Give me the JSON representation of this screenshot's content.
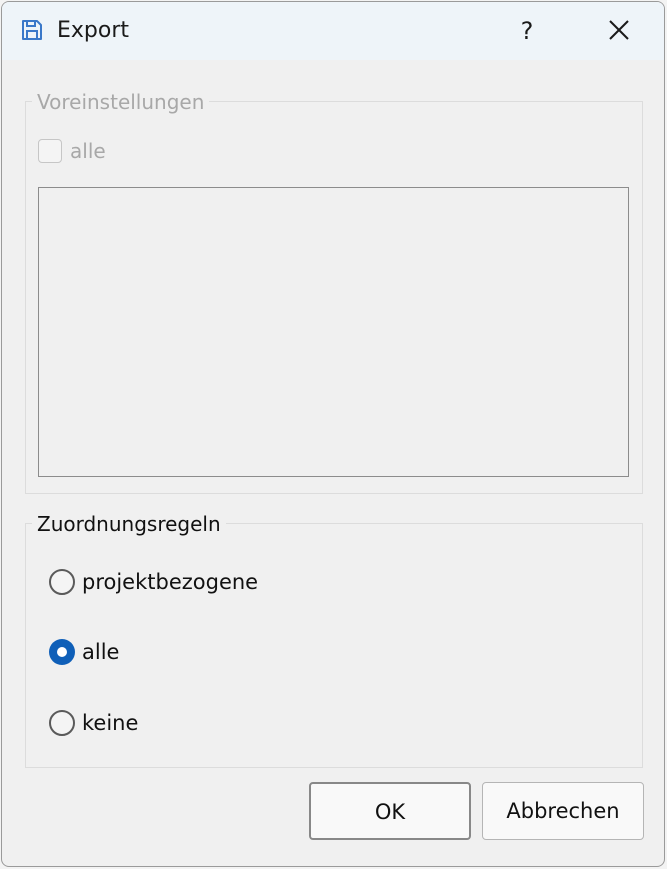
{
  "window": {
    "title": "Export",
    "help_label": "?"
  },
  "presets": {
    "legend": "Voreinstellungen",
    "all_label": "alle",
    "all_checked": false,
    "enabled": false,
    "items": []
  },
  "rules": {
    "legend": "Zuordnungsregeln",
    "options": [
      {
        "label": "projektbezogene",
        "selected": false
      },
      {
        "label": "alle",
        "selected": true
      },
      {
        "label": "keine",
        "selected": false
      }
    ]
  },
  "buttons": {
    "ok_label": "OK",
    "cancel_label": "Abbrechen"
  },
  "colors": {
    "accent": "#0f5fb8",
    "disabled_text": "#a8a8a8"
  }
}
